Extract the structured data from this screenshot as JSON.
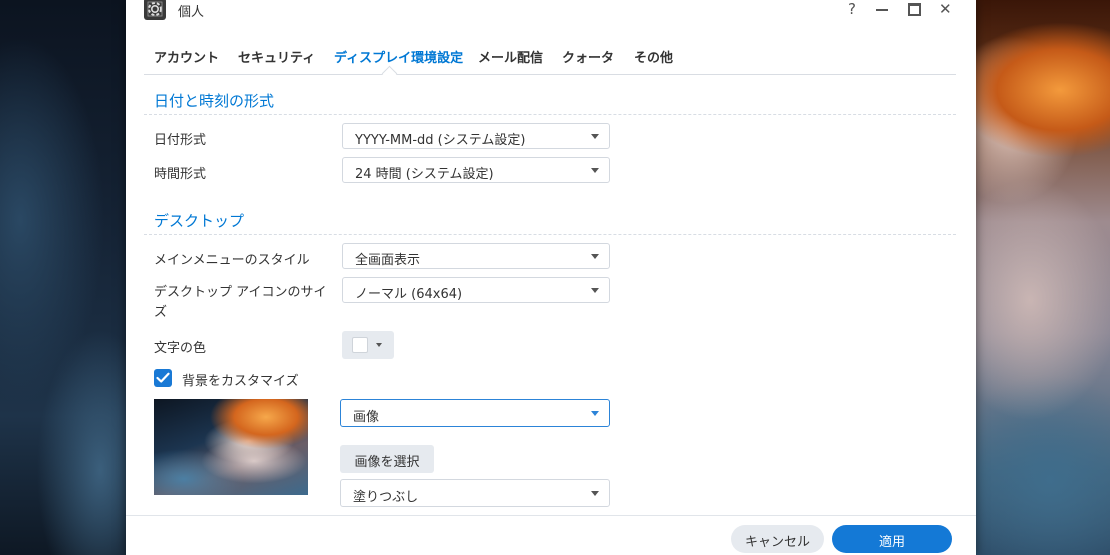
{
  "window": {
    "title": "個人",
    "controls": {
      "help": "?",
      "close": "✕"
    }
  },
  "tabs": [
    {
      "label": "アカウント",
      "active": false
    },
    {
      "label": "セキュリティ",
      "active": false
    },
    {
      "label": "ディスプレイ環境設定",
      "active": true
    },
    {
      "label": "メール配信",
      "active": false
    },
    {
      "label": "クォータ",
      "active": false
    },
    {
      "label": "その他",
      "active": false
    }
  ],
  "datetime": {
    "section_title": "日付と時刻の形式",
    "date_format": {
      "label": "日付形式",
      "value": "YYYY-MM-dd (システム設定)"
    },
    "time_format": {
      "label": "時間形式",
      "value": "24 時間 (システム設定)"
    }
  },
  "desktop": {
    "section_title": "デスクトップ",
    "menu_style": {
      "label": "メインメニューのスタイル",
      "value": "全画面表示"
    },
    "icon_size": {
      "label": "デスクトップ アイコンのサイズ",
      "value": "ノーマル (64x64)"
    },
    "text_color": {
      "label": "文字の色",
      "value": "#ffffff"
    },
    "custom_background": {
      "label": "背景をカスタマイズ",
      "checked": true,
      "type": "画像",
      "select_image_label": "画像を選択",
      "fill_mode": "塗りつぶし"
    }
  },
  "footer": {
    "cancel_label": "キャンセル",
    "apply_label": "適用"
  },
  "colors": {
    "accent": "#0078d4",
    "primary_button": "#1479d6",
    "secondary_button": "#e6eaef"
  }
}
